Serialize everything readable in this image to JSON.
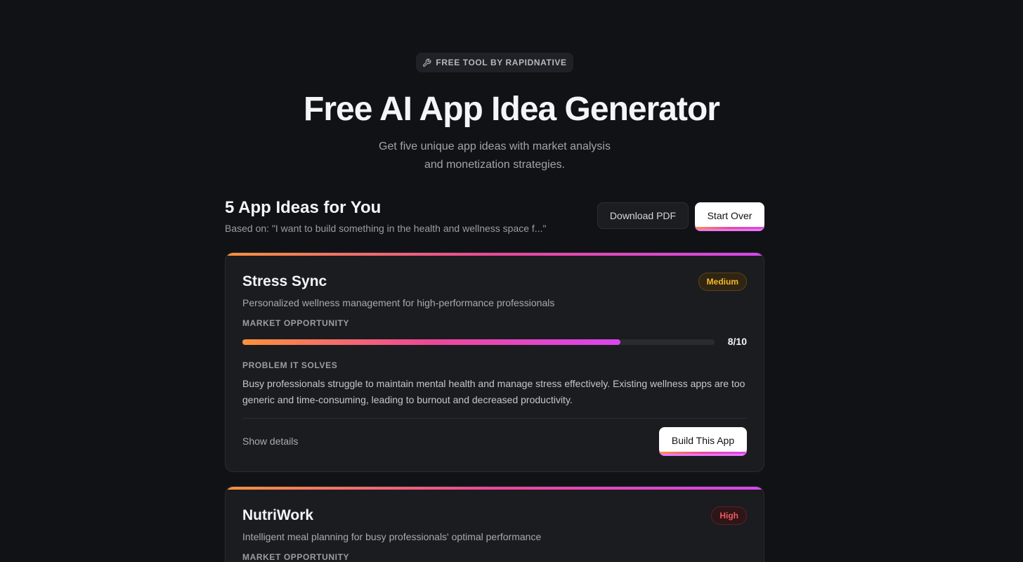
{
  "header": {
    "badge": "FREE TOOL BY RAPIDNATIVE",
    "badge_icon": "wrench-icon",
    "title": "Free AI App Idea Generator",
    "subtitle": "Get five unique app ideas with market analysis and monetization strategies."
  },
  "results": {
    "title": "5 App Ideas for You",
    "based_on": "Based on: \"I want to build something in the health and wellness space f...\"",
    "download_label": "Download PDF",
    "start_over_label": "Start Over"
  },
  "ideas": [
    {
      "name": "Stress Sync",
      "tagline": "Personalized wellness management for high-performance professionals",
      "competition": "Medium",
      "market_label": "MARKET OPPORTUNITY",
      "market_score": 8,
      "market_score_text": "8/10",
      "problem_label": "PROBLEM IT SOLVES",
      "problem": "Busy professionals struggle to maintain mental health and manage stress effectively. Existing wellness apps are too generic and time-consuming, leading to burnout and decreased productivity.",
      "show_details": "Show details",
      "build_label": "Build This App"
    },
    {
      "name": "NutriWork",
      "tagline": "Intelligent meal planning for busy professionals' optimal performance",
      "competition": "High",
      "market_label": "MARKET OPPORTUNITY"
    }
  ],
  "colors": {
    "background": "#111216",
    "card": "#1b1c20",
    "accent_start": "#fb923c",
    "accent_mid": "#ec4899",
    "accent_end": "#d946ef",
    "medium": "#f5b82a",
    "high": "#f0595e"
  }
}
